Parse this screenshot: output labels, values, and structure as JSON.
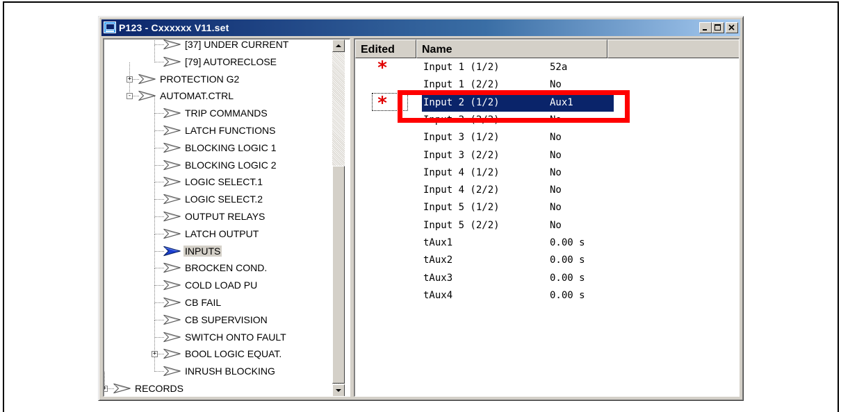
{
  "window": {
    "title": "P123 - Cxxxxxx V11.set",
    "buttons": {
      "minimize": "_",
      "maximize": "□",
      "close": "×"
    }
  },
  "tree": {
    "items": [
      {
        "label": "[37] UNDER CURRENT",
        "level": 2,
        "icon": "chevron-gray"
      },
      {
        "label": "[79] AUTORECLOSE",
        "level": 2,
        "icon": "chevron-gray"
      },
      {
        "label": "PROTECTION G2",
        "level": 1,
        "icon": "chevron-gray",
        "expander": "+"
      },
      {
        "label": "AUTOMAT.CTRL",
        "level": 1,
        "icon": "chevron-gray",
        "expander": "-"
      },
      {
        "label": "TRIP COMMANDS",
        "level": 2,
        "icon": "chevron-gray"
      },
      {
        "label": "LATCH FUNCTIONS",
        "level": 2,
        "icon": "chevron-gray"
      },
      {
        "label": "BLOCKING LOGIC 1",
        "level": 2,
        "icon": "chevron-gray"
      },
      {
        "label": "BLOCKING LOGIC 2",
        "level": 2,
        "icon": "chevron-gray"
      },
      {
        "label": "LOGIC SELECT.1",
        "level": 2,
        "icon": "chevron-gray"
      },
      {
        "label": "LOGIC SELECT.2",
        "level": 2,
        "icon": "chevron-gray"
      },
      {
        "label": "OUTPUT RELAYS",
        "level": 2,
        "icon": "chevron-gray"
      },
      {
        "label": "LATCH OUTPUT",
        "level": 2,
        "icon": "chevron-gray"
      },
      {
        "label": "INPUTS",
        "level": 2,
        "icon": "chevron-blue",
        "selected": true
      },
      {
        "label": "BROCKEN COND.",
        "level": 2,
        "icon": "chevron-gray"
      },
      {
        "label": "COLD LOAD PU",
        "level": 2,
        "icon": "chevron-gray"
      },
      {
        "label": "CB FAIL",
        "level": 2,
        "icon": "chevron-gray"
      },
      {
        "label": "CB SUPERVISION",
        "level": 2,
        "icon": "chevron-gray"
      },
      {
        "label": "SWITCH ONTO FAULT",
        "level": 2,
        "icon": "chevron-gray"
      },
      {
        "label": "BOOL LOGIC EQUAT.",
        "level": 2,
        "icon": "chevron-gray",
        "expander": "+"
      },
      {
        "label": "INRUSH BLOCKING",
        "level": 2,
        "icon": "chevron-gray"
      },
      {
        "label": "RECORDS",
        "level": 0,
        "icon": "chevron-gray",
        "expander": "+"
      }
    ]
  },
  "list": {
    "headers": {
      "edited": "Edited",
      "name": "Name"
    },
    "rows": [
      {
        "name": "Input 1 (1/2)",
        "value": "52a",
        "edited": "*"
      },
      {
        "name": "Input 1 (2/2)",
        "value": "No",
        "edited": ""
      },
      {
        "name": "Input 2 (1/2)",
        "value": "Aux1",
        "edited": "*",
        "selected": true
      },
      {
        "name": "Input 2 (2/2)",
        "value": "No",
        "edited": ""
      },
      {
        "name": "Input 3 (1/2)",
        "value": "No",
        "edited": ""
      },
      {
        "name": "Input 3 (2/2)",
        "value": "No",
        "edited": ""
      },
      {
        "name": "Input 4 (1/2)",
        "value": "No",
        "edited": ""
      },
      {
        "name": "Input 4 (2/2)",
        "value": "No",
        "edited": ""
      },
      {
        "name": "Input 5 (1/2)",
        "value": "No",
        "edited": ""
      },
      {
        "name": "Input 5 (2/2)",
        "value": "No",
        "edited": ""
      },
      {
        "name": "tAux1",
        "value": "0.00 s",
        "edited": ""
      },
      {
        "name": "tAux2",
        "value": "0.00 s",
        "edited": ""
      },
      {
        "name": "tAux3",
        "value": "0.00 s",
        "edited": ""
      },
      {
        "name": "tAux4",
        "value": "0.00 s",
        "edited": ""
      }
    ]
  },
  "colors": {
    "title_start": "#0a246a",
    "title_end": "#a6caf0",
    "selection": "#0a246a",
    "edited_star": "#e00000",
    "highlight": "#ff0000"
  }
}
